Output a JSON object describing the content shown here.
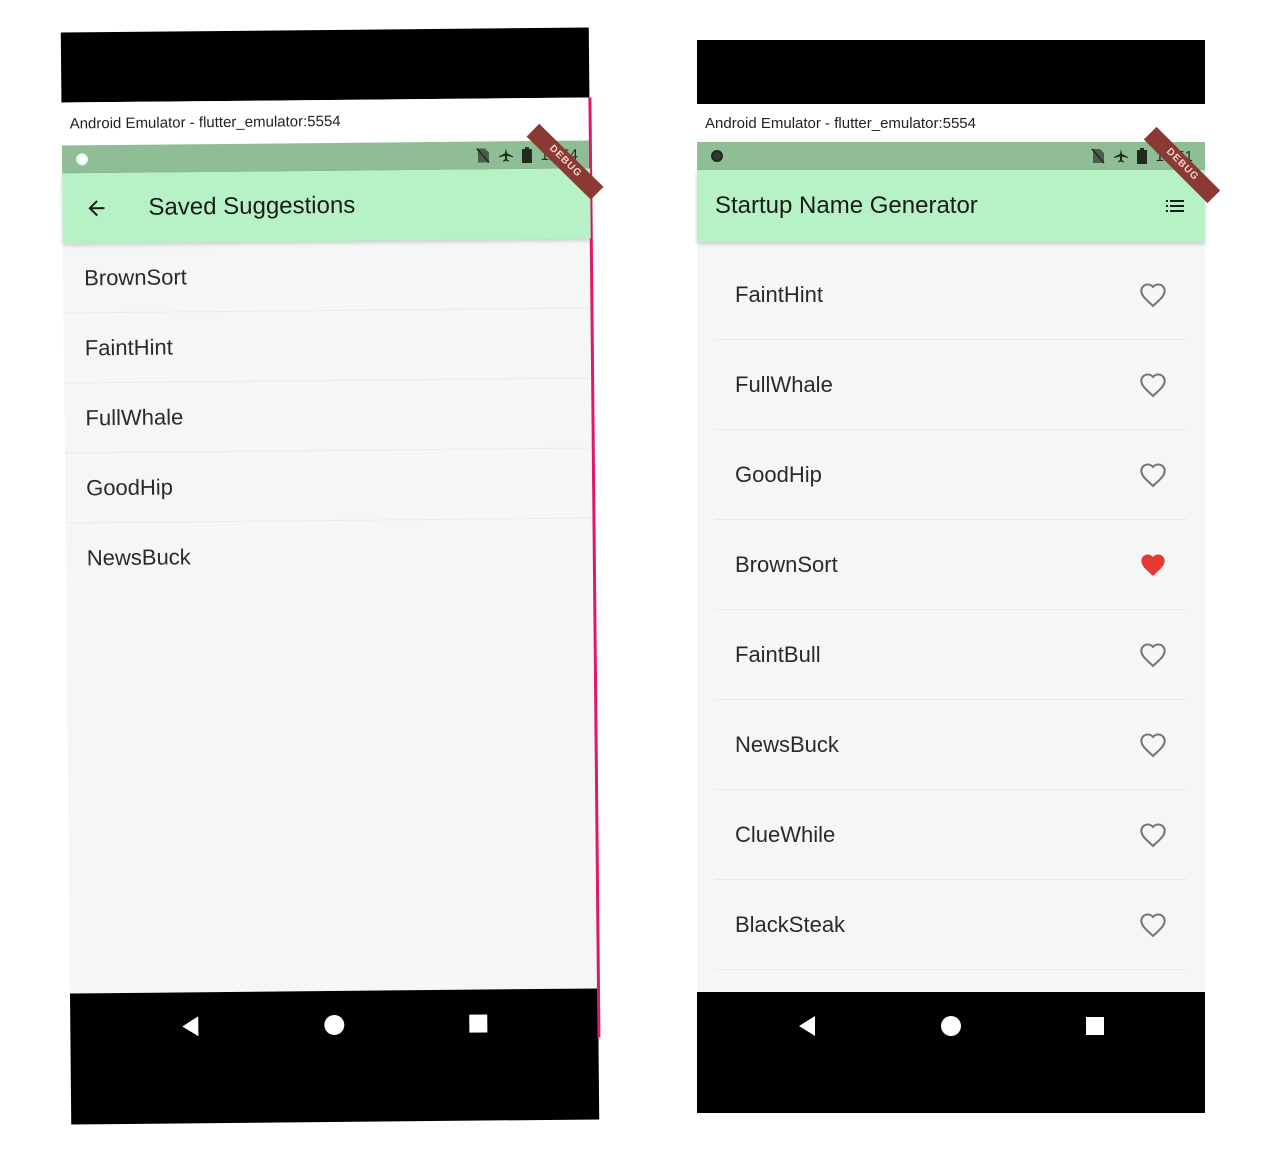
{
  "left_screen": {
    "window_title": "Android Emulator - flutter_emulator:5554",
    "status_time": "12:54",
    "debug_label": "DEBUG",
    "appbar_title": "Saved Suggestions",
    "saved_items": [
      "BrownSort",
      "FaintHint",
      "FullWhale",
      "GoodHip",
      "NewsBuck"
    ]
  },
  "right_screen": {
    "window_title": "Android Emulator - flutter_emulator:5554",
    "status_time": "12:51",
    "debug_label": "DEBUG",
    "appbar_title": "Startup Name Generator",
    "suggestions": [
      {
        "label": "FaintHint",
        "saved": false
      },
      {
        "label": "FullWhale",
        "saved": false
      },
      {
        "label": "GoodHip",
        "saved": false
      },
      {
        "label": "BrownSort",
        "saved": true
      },
      {
        "label": "FaintBull",
        "saved": false
      },
      {
        "label": "NewsBuck",
        "saved": false
      },
      {
        "label": "ClueWhile",
        "saved": false
      },
      {
        "label": "BlackSteak",
        "saved": false
      }
    ]
  },
  "colors": {
    "appbar": "#b6f2c6",
    "status_bar": "#8fbe96",
    "heart_filled": "#e53935",
    "heart_outline": "#777777"
  },
  "icons": {
    "back": "arrow-left-icon",
    "list": "list-icon",
    "heart": "heart-icon",
    "nav_back": "triangle-back-icon",
    "nav_home": "circle-home-icon",
    "nav_recents": "square-recents-icon"
  }
}
